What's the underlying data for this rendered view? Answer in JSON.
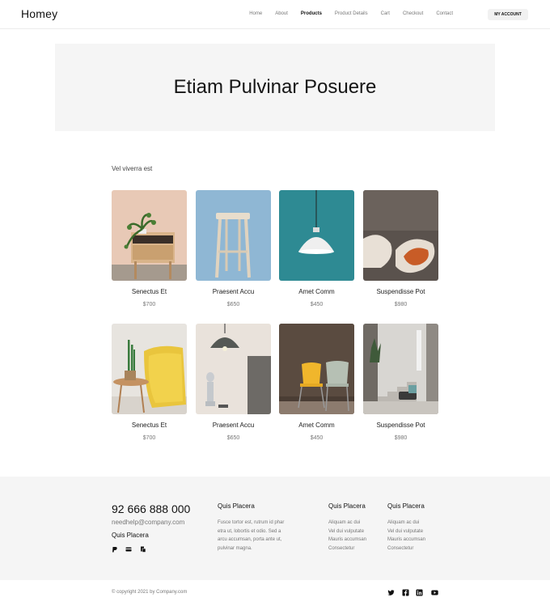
{
  "header": {
    "logo": "Homey",
    "nav": [
      "Home",
      "About",
      "Products",
      "Product Details",
      "Cart",
      "Checkout",
      "Contact"
    ],
    "active_nav": "Products",
    "account_button": "MY ACCOUNT"
  },
  "hero": {
    "title": "Etiam Pulvinar Posuere"
  },
  "section_subtitle": "Vel viverra est",
  "products": [
    {
      "name": "Senectus Et",
      "price": "$700"
    },
    {
      "name": "Praesent Accu",
      "price": "$650"
    },
    {
      "name": "Amet Comm",
      "price": "$450"
    },
    {
      "name": "Suspendisse Pot",
      "price": "$980"
    },
    {
      "name": "Senectus Et",
      "price": "$700"
    },
    {
      "name": "Praesent Accu",
      "price": "$650"
    },
    {
      "name": "Amet Comm",
      "price": "$450"
    },
    {
      "name": "Suspendisse Pot",
      "price": "$980"
    }
  ],
  "footer": {
    "phone": "92 666 888 000",
    "email": "needhelp@company.com",
    "left_title": "Quis Placera",
    "col1": {
      "title": "Quis Placera",
      "text": "Fusce tortor est, rutrum id phar etra ut, lobortis et odio. Sed a arcu accumsan, porta ante ut, pulvinar magna."
    },
    "col2": {
      "title": "Quis Placera",
      "items": [
        "Aliquam ac dui",
        "Vel dui vulputate",
        "Mauris accumsan",
        "Consectetur"
      ]
    },
    "col3": {
      "title": "Quis Placera",
      "items": [
        "Aliquam ac dui",
        "Vel dui vulputate",
        "Mauris accumsan",
        "Consectetur"
      ]
    },
    "payment_icons": [
      "paypal-icon",
      "credit-card-icon",
      "wallet-icon"
    ]
  },
  "bottom_bar": {
    "copyright": "© copyright 2021 by Company.com",
    "social_icons": [
      "twitter-icon",
      "facebook-icon",
      "linkedin-icon",
      "youtube-icon"
    ]
  }
}
